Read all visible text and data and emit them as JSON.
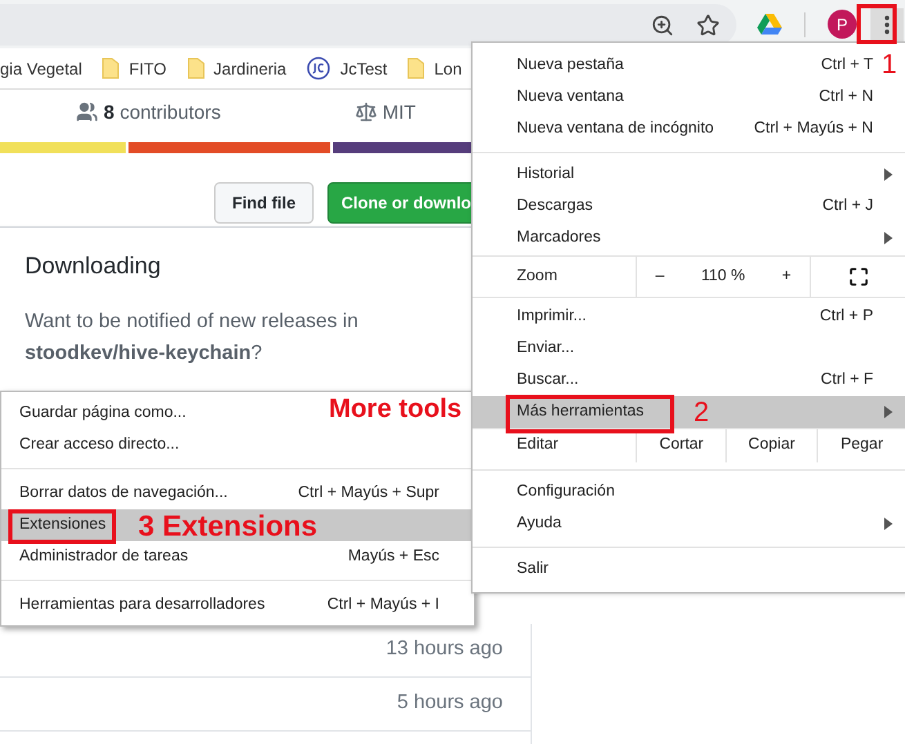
{
  "toolbar": {
    "avatar": "P"
  },
  "bookmarks": [
    {
      "label": "gia Vegetal",
      "kind": "text"
    },
    {
      "label": "FITO",
      "kind": "folder"
    },
    {
      "label": "Jardineria",
      "kind": "folder"
    },
    {
      "label": "JcTest",
      "kind": "site"
    },
    {
      "label": "Lon",
      "kind": "folder"
    }
  ],
  "repo": {
    "contributors_count": "8",
    "contributors_label": "contributors",
    "license": "MIT",
    "language_bar": [
      {
        "color": "#f1e05a",
        "level": 0.14
      },
      {
        "color": "#e34c26",
        "level": 0.224
      },
      {
        "color": "#563d7c",
        "level": 0.636
      }
    ],
    "buttons": [
      {
        "label": "Find file",
        "kind": "default"
      },
      {
        "label": "Clone or downlo",
        "kind": "primary"
      }
    ],
    "commit_times": [
      "13 hours ago",
      "5 hours ago"
    ]
  },
  "release_popup": {
    "title": "Downloading",
    "text": "Want to be notified of new releases in **stoodkev/hive-keychain**?"
  },
  "menu": {
    "sections": [
      {
        "items": [
          {
            "kind": "item",
            "label": "Nueva pestaña",
            "shortcut": "Ctrl + T",
            "has_submenu": false,
            "selected": false
          },
          {
            "kind": "item",
            "label": "Nueva ventana",
            "shortcut": "Ctrl + N",
            "has_submenu": false,
            "selected": false
          },
          {
            "kind": "item",
            "label": "Nueva ventana de incógnito",
            "shortcut": "Ctrl + Mayús + N",
            "has_submenu": false,
            "selected": false
          }
        ]
      },
      {
        "items": [
          {
            "kind": "item",
            "label": "Historial",
            "has_submenu": true,
            "selected": false
          },
          {
            "kind": "item",
            "label": "Descargas",
            "shortcut": "Ctrl + J",
            "has_submenu": false,
            "selected": false
          },
          {
            "kind": "item",
            "label": "Marcadores",
            "has_submenu": true,
            "selected": false
          }
        ]
      },
      {
        "items": [
          {
            "kind": "zoom",
            "label": "Zoom",
            "minus": "–",
            "value": "110 %",
            "plus": "+"
          }
        ]
      },
      {
        "items": [
          {
            "kind": "item",
            "label": "Imprimir...",
            "shortcut": "Ctrl + P",
            "has_submenu": false,
            "selected": false
          },
          {
            "kind": "item",
            "label": "Enviar...",
            "has_submenu": false,
            "selected": false
          },
          {
            "kind": "item",
            "label": "Buscar...",
            "shortcut": "Ctrl + F",
            "has_submenu": false,
            "selected": false
          },
          {
            "kind": "item",
            "label": "Más herramientas",
            "has_submenu": true,
            "selected": true
          },
          {
            "kind": "edit",
            "label": "Editar",
            "actions": [
              "Cortar",
              "Copiar",
              "Pegar"
            ]
          }
        ]
      },
      {
        "items": [
          {
            "kind": "item",
            "label": "Configuración",
            "has_submenu": false,
            "selected": false
          },
          {
            "kind": "item",
            "label": "Ayuda",
            "has_submenu": true,
            "selected": false
          }
        ]
      },
      {
        "items": [
          {
            "kind": "item",
            "label": "Salir",
            "has_submenu": false,
            "selected": false
          }
        ]
      }
    ]
  },
  "submenu": {
    "sections": [
      {
        "items": [
          {
            "label": "Guardar página como...",
            "selected": false
          },
          {
            "label": "Crear acceso directo...",
            "selected": false
          }
        ]
      },
      {
        "items": [
          {
            "label": "Borrar datos de navegación...",
            "shortcut": "Ctrl + Mayús + Supr",
            "selected": false
          },
          {
            "label": "Extensiones",
            "selected": true
          },
          {
            "label": "Administrador de tareas",
            "shortcut": "Mayús + Esc",
            "selected": false
          }
        ]
      },
      {
        "items": [
          {
            "label": "Herramientas para desarrolladores",
            "shortcut": "Ctrl + Mayús + I",
            "selected": false
          }
        ]
      }
    ]
  },
  "annotations": [
    "1",
    "More tools",
    "2",
    "3 Extensions"
  ]
}
